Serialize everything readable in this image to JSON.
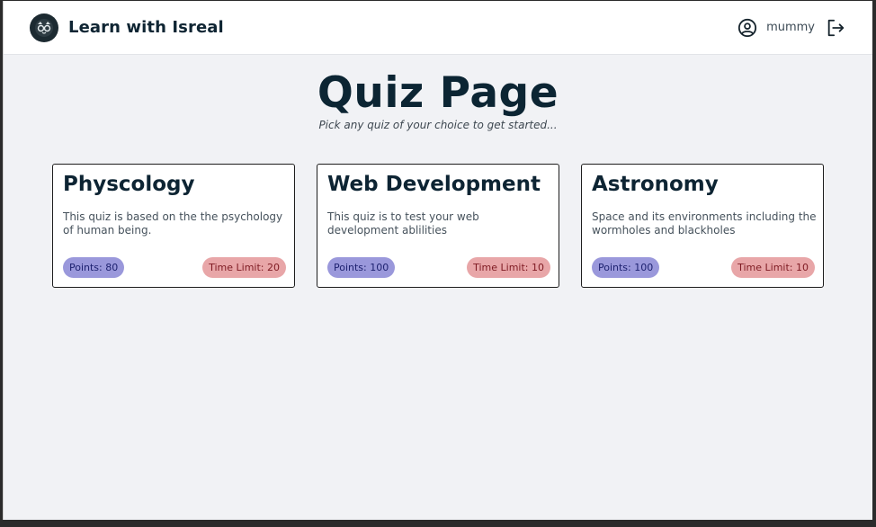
{
  "navbar": {
    "brand_name": "Learn with Isreal",
    "logo_icon": "owl-glasses-icon",
    "username": "mummy",
    "user_icon": "user-circle-icon",
    "logout_icon": "logout-icon"
  },
  "hero": {
    "title": "Quiz Page",
    "subtitle": "Pick any quiz of your choice to get started..."
  },
  "quizzes": [
    {
      "title": "Physcology",
      "description": "This quiz is based on the the psychology of human being.",
      "points": "Points: 80",
      "time_limit": "Time Limit: 20"
    },
    {
      "title": "Web Development",
      "description": "This quiz is to test your web development ablilities",
      "points": "Points: 100",
      "time_limit": "Time Limit: 10"
    },
    {
      "title": "Astronomy",
      "description": "Space and its environments including the wormholes and blackholes",
      "points": "Points: 100",
      "time_limit": "Time Limit: 10"
    }
  ],
  "colors": {
    "navy_text": "#0c2533",
    "points_badge_bg": "#9a98db",
    "time_badge_bg": "#e8a6a8",
    "page_bg": "#f1f2f5"
  }
}
